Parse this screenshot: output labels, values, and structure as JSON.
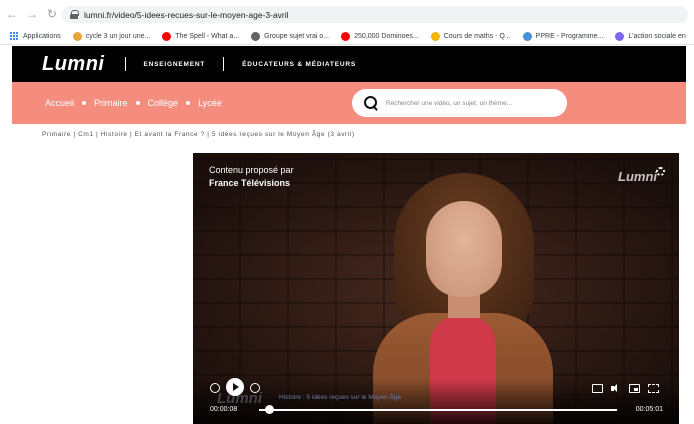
{
  "browser": {
    "url": "lumni.fr/video/5-idees-recues-sur-le-moyen-age-3-avril",
    "bookmarks": [
      {
        "label": "Applications",
        "icon": "apps-grid-icon",
        "color": "#4285f4"
      },
      {
        "label": "cycle 3 un jour une...",
        "icon": "chrome-icon",
        "color": "#e8a33d"
      },
      {
        "label": "The Spell - What a...",
        "icon": "youtube-icon",
        "color": "#ff0000"
      },
      {
        "label": "Groupe sujet vrai o...",
        "icon": "globe-icon",
        "color": "#5f6368"
      },
      {
        "label": "250,000 Dominoes...",
        "icon": "youtube-icon",
        "color": "#ff0000"
      },
      {
        "label": "Cours de maths - Q...",
        "icon": "bookmark-icon",
        "color": "#f4b400"
      },
      {
        "label": "PPRE - Programme...",
        "icon": "bookmark-icon",
        "color": "#4a90d9"
      },
      {
        "label": "L'action sociale en",
        "icon": "bookmark-icon",
        "color": "#7b68ee"
      }
    ]
  },
  "site": {
    "logo": "Lumni",
    "top_links": [
      "ENSEIGNEMENT",
      "ÉDUCATEURS & MÉDIATEURS"
    ],
    "nav": [
      "Accueil",
      "Primaire",
      "Collège",
      "Lycée"
    ],
    "search_placeholder": "Rechercher une vidéo, un sujet, un thème...",
    "accent_color": "#f58d7f"
  },
  "breadcrumb": "Primaire  |  Cm1  |  Histoire  |  Et avant la France ?  |  5 idées reçues sur le Moyen Âge (3 avril)",
  "video": {
    "credit_line1": "Contenu proposé par",
    "credit_line2": "France Télévisions",
    "watermark": "Lumni",
    "title": "Histoire : 5 idées reçues sur le Moyen Âge",
    "elapsed": "00:00:08",
    "duration": "00:05:01",
    "progress": 0.027
  }
}
